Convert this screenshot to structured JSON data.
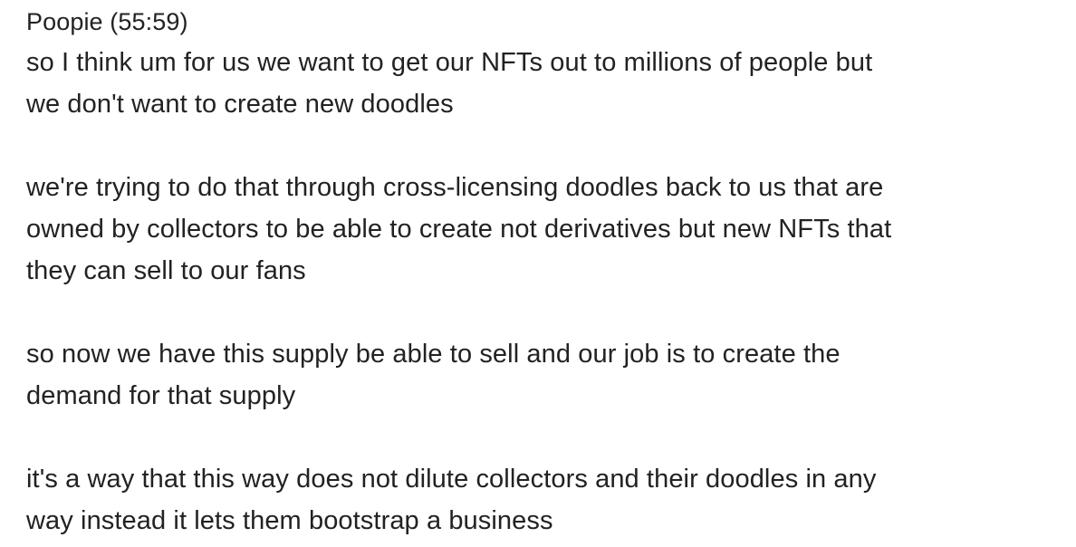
{
  "speaker": {
    "name": "Poopie",
    "timestamp": "(55:59)"
  },
  "paragraphs": [
    "so I think um for us we want to get our NFTs out to millions of people but\nwe don't want to create new doodles",
    "we're trying to do that through cross-licensing doodles back to us that are\nowned by collectors to be able to create not derivatives but new NFTs that\nthey can sell to our fans",
    "so now we have this supply be able to sell and our job is to create the\ndemand for that supply",
    "it's a way that this way does not dilute collectors and their doodles in any\nway instead it lets them bootstrap a business"
  ]
}
